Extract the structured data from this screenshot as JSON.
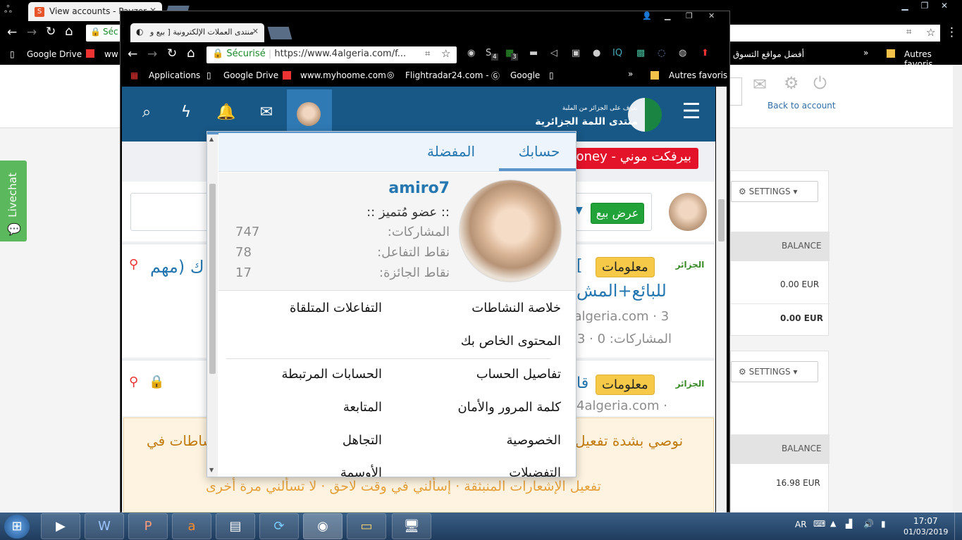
{
  "outer_browser": {
    "tab_title": "View accounts - Payzer",
    "omnibox_text": "Séc",
    "bookmarks": [
      "Google Drive",
      "ww"
    ],
    "bookmark_right_arabic": "أفضل مواقع التسوق",
    "other_bookmarks": "Autres favoris"
  },
  "background_page": {
    "back_to_account": "Back to account",
    "settings_label": "SETTINGS",
    "balance_label": "BALANCE",
    "balances_panel1": [
      "0.00 EUR",
      "0.00 EUR"
    ],
    "balance_panel2": "16.98 EUR"
  },
  "inner_browser": {
    "tab_title": "منتدى العملات الإلكترونية [ بيع و",
    "secure_label": "Sécurisé",
    "url": "https://www.4algeria.com/f...",
    "ext_badges": [
      "4",
      "3"
    ],
    "bookmarks": [
      "Applications",
      "Google Drive",
      "www.myhoome.com",
      "Flightradar24.com -",
      "Google"
    ],
    "other_bookmarks": "Autres favoris"
  },
  "site": {
    "logo_line1": "تعرف على الجزائر من الملبة",
    "logo_line2": "منتدى اللمة الجزائرية",
    "sponsor_text": "بيرفكت موني - Money",
    "sell_button": "عرض بيع",
    "threads": [
      {
        "badge": "معلومات",
        "title": "للبائع+المش",
        "title_extra": "[ ",
        "side_text": "ك (مهم",
        "meta": "4algeria.com · 3",
        "stats": "المشاركات: 0 · 3",
        "logo": "الجزائر"
      },
      {
        "badge": "معلومات",
        "title": "قا",
        "meta": "4algeria.com ·",
        "logo": "الجزائر"
      }
    ],
    "notice_line1": "نوصي بشدة تفعيل",
    "notice_line1_left": "شاطات في",
    "notice_line2": "تفعيل الإشعارات المنبثقة · إسألني في وقت لاحق · لا تسألني مرة أخرى"
  },
  "dropdown": {
    "tab_account": "حسابك",
    "tab_favorites": "المفضلة",
    "username": "amiro7",
    "user_title": ":: عضو مُتميز ::",
    "stats": [
      {
        "label": "المشاركات:",
        "value": "747"
      },
      {
        "label": "نقاط التفاعل:",
        "value": "78"
      },
      {
        "label": "نقاط الجائزة:",
        "value": "17"
      }
    ],
    "menu_right": [
      "خلاصة النشاطات",
      "المحتوى الخاص بك",
      "تفاصيل الحساب",
      "كلمة المرور والأمان",
      "الخصوصية",
      "التفضيلات"
    ],
    "menu_left": [
      "التفاعلات المتلقاة",
      "الحسابات المرتبطة",
      "المتابعة",
      "التجاهل",
      "الأوسمة"
    ]
  },
  "livechat": "Livechat",
  "taskbar": {
    "lang": "AR",
    "time": "17:07",
    "date": "01/03/2019"
  },
  "colors": {
    "header_blue": "#185886",
    "link_blue": "#2577b1",
    "livechat_green": "#5cb85c",
    "sell_green": "#22a33a",
    "info_yellow": "#f7c948"
  }
}
